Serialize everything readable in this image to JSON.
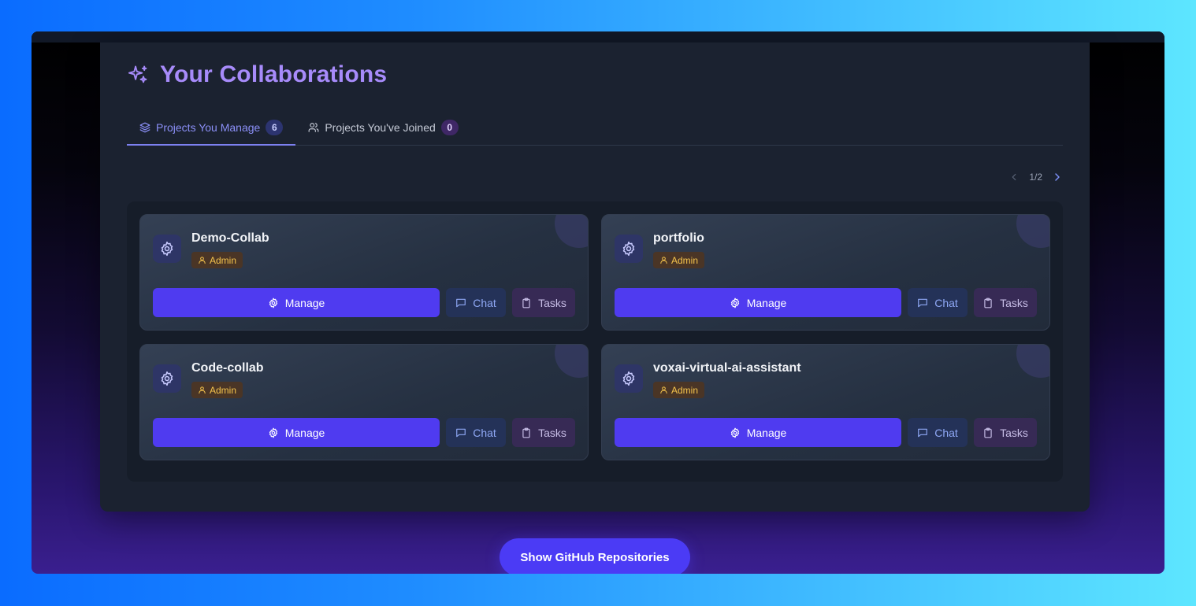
{
  "header": {
    "title": "Your Collaborations"
  },
  "tabs": [
    {
      "label": "Projects You Manage",
      "count": "6",
      "active": true
    },
    {
      "label": "Projects You've Joined",
      "count": "0",
      "active": false
    }
  ],
  "pager": {
    "text": "1/2"
  },
  "projects": [
    {
      "name": "Demo-Collab",
      "role": "Admin",
      "manage_label": "Manage",
      "chat_label": "Chat",
      "tasks_label": "Tasks"
    },
    {
      "name": "portfolio",
      "role": "Admin",
      "manage_label": "Manage",
      "chat_label": "Chat",
      "tasks_label": "Tasks"
    },
    {
      "name": "Code-collab",
      "role": "Admin",
      "manage_label": "Manage",
      "chat_label": "Chat",
      "tasks_label": "Tasks"
    },
    {
      "name": "voxai-virtual-ai-assistant",
      "role": "Admin",
      "manage_label": "Manage",
      "chat_label": "Chat",
      "tasks_label": "Tasks"
    }
  ],
  "footer": {
    "github_button_label": "Show GitHub Repositories"
  },
  "colors": {
    "accent": "#a78bfa",
    "manage": "#4f3bf0",
    "role_badge": "#f5c44c"
  },
  "icons": [
    "sparkles-icon",
    "layers-icon",
    "users-icon",
    "settings-icon",
    "user-icon",
    "message-square-icon",
    "clipboard-icon",
    "chevron-left-icon",
    "chevron-right-icon"
  ]
}
